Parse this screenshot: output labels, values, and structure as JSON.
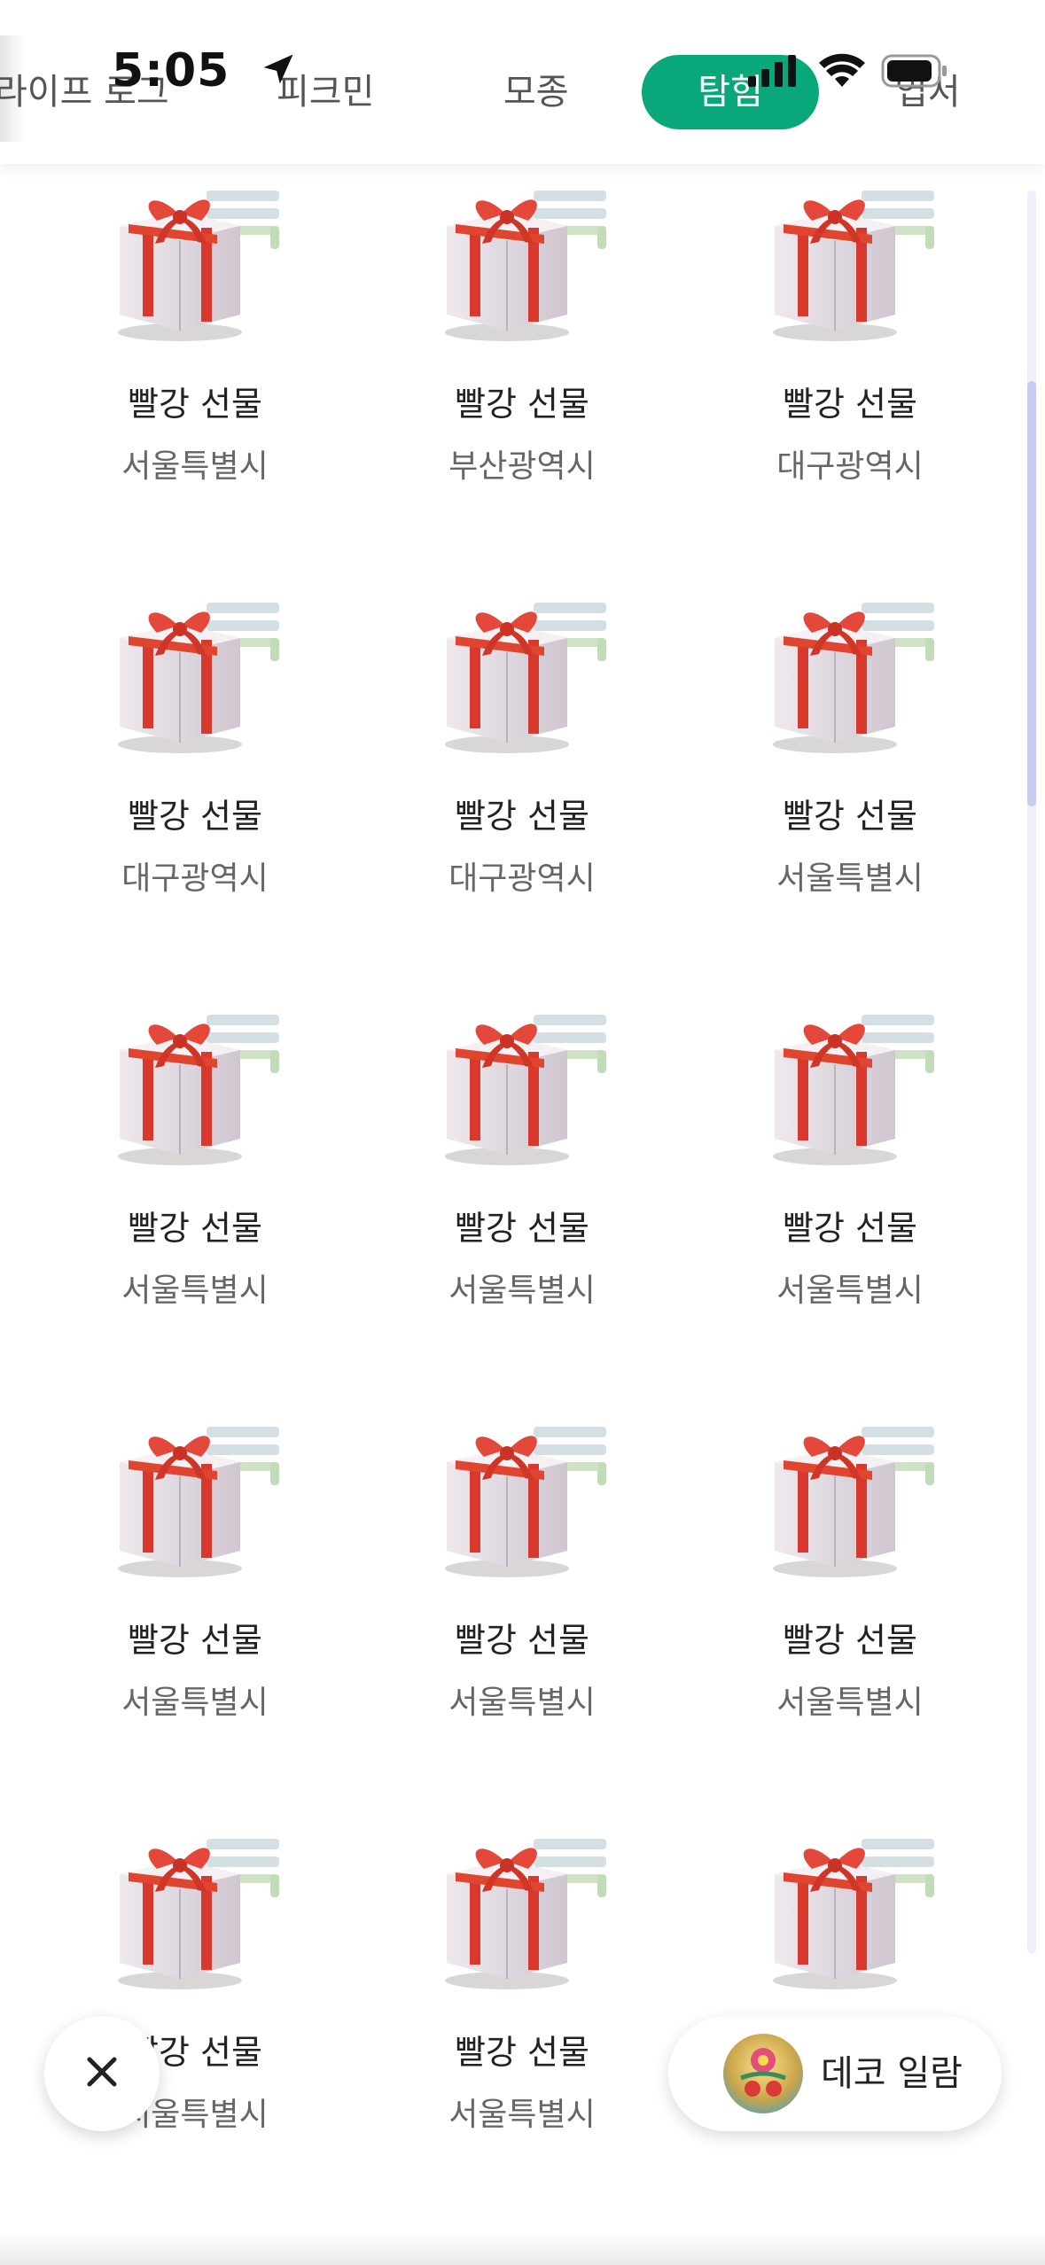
{
  "status_bar": {
    "time": "5:05",
    "icons": [
      "location-arrow-icon",
      "cellular-signal-icon",
      "wifi-icon",
      "battery-icon"
    ]
  },
  "tabs": [
    {
      "label": "라이프 로그",
      "active": false
    },
    {
      "label": "피크민",
      "active": false
    },
    {
      "label": "모종",
      "active": false
    },
    {
      "label": "탐험",
      "active": true
    },
    {
      "label": "엽서",
      "active": false
    }
  ],
  "accent_color": "#0aa77a",
  "items": [
    {
      "name": "빨강 선물",
      "location": "서울특별시"
    },
    {
      "name": "빨강 선물",
      "location": "부산광역시"
    },
    {
      "name": "빨강 선물",
      "location": "대구광역시"
    },
    {
      "name": "빨강 선물",
      "location": "대구광역시"
    },
    {
      "name": "빨강 선물",
      "location": "대구광역시"
    },
    {
      "name": "빨강 선물",
      "location": "서울특별시"
    },
    {
      "name": "빨강 선물",
      "location": "서울특별시"
    },
    {
      "name": "빨강 선물",
      "location": "서울특별시"
    },
    {
      "name": "빨강 선물",
      "location": "서울특별시"
    },
    {
      "name": "빨강 선물",
      "location": "서울특별시"
    },
    {
      "name": "빨강 선물",
      "location": "서울특별시"
    },
    {
      "name": "빨강 선물",
      "location": "서울특별시"
    },
    {
      "name": "빨강 선물",
      "location": "서울특별시"
    },
    {
      "name": "빨강 선물",
      "location": "서울특별시"
    },
    {
      "name": "빨강 선물",
      "location": "서울특별시"
    }
  ],
  "floating": {
    "close_icon": "close-icon",
    "deco_label": "데코 일람"
  }
}
